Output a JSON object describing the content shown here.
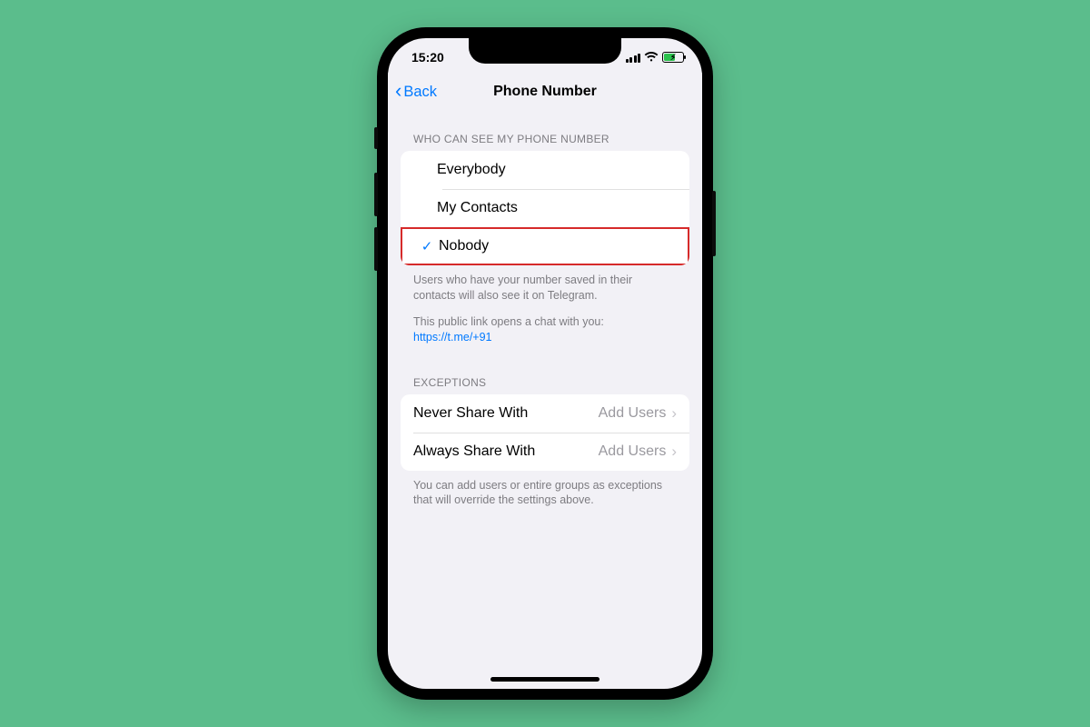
{
  "statusbar": {
    "time": "15:20"
  },
  "nav": {
    "back_label": "Back",
    "title": "Phone Number"
  },
  "visibility": {
    "header": "WHO CAN SEE MY PHONE NUMBER",
    "options": [
      {
        "label": "Everybody",
        "selected": false
      },
      {
        "label": "My Contacts",
        "selected": false
      },
      {
        "label": "Nobody",
        "selected": true,
        "highlighted": true
      }
    ],
    "footer1": "Users who have your number saved in their contacts will also see it on Telegram.",
    "footer2_prefix": "This public link opens a chat with you:",
    "footer2_link": "https://t.me/+91"
  },
  "exceptions": {
    "header": "EXCEPTIONS",
    "rows": [
      {
        "label": "Never Share With",
        "value": "Add Users"
      },
      {
        "label": "Always Share With",
        "value": "Add Users"
      }
    ],
    "footer": "You can add users or entire groups as exceptions that will override the settings above."
  }
}
